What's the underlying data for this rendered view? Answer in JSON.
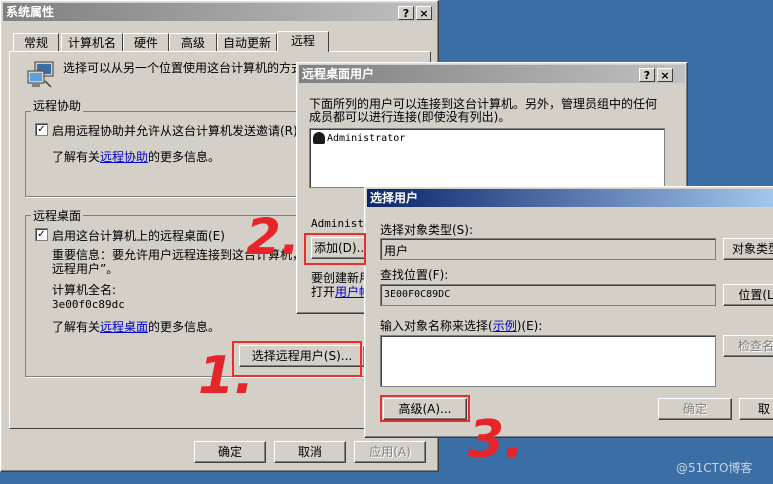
{
  "sysprops": {
    "title": "系统属性",
    "tabs": [
      "常规",
      "计算机名",
      "硬件",
      "高级",
      "自动更新",
      "远程"
    ],
    "intro": "选择可以从另一个位置使用这台计算机的方式",
    "assist": {
      "group_label": "远程协助",
      "check_label": "启用远程协助并允许从这台计算机发送邀请(R)",
      "learn_prefix": "了解有关",
      "learn_link": "远程协助",
      "learn_suffix": "的更多信息。"
    },
    "desktop": {
      "group_label": "远程桌面",
      "check_label": "启用这台计算机上的远程桌面(E)",
      "important1": "重要信息：要允许用户远程连接到这台计算机，",
      "important2": "远程用户”。",
      "fullname_label": "计算机全名:",
      "fullname": "3e00f0c89dc",
      "learn_prefix": "了解有关",
      "learn_link": "远程桌面",
      "learn_suffix": "的更多信息。",
      "select_users_btn": "选择远程用户(S)..."
    },
    "buttons": {
      "ok": "确定",
      "cancel": "取消",
      "apply": "应用(A)"
    }
  },
  "rdu": {
    "title": "远程桌面用户",
    "desc1": "下面所列的用户可以连接到这台计算机。另外，管理员组中的任何",
    "desc2": "成员都可以进行连接(即使没有列出)。",
    "users": [
      "Administrator"
    ],
    "status": "Administr",
    "add_btn": "添加(D)...",
    "create1": "要创建新用",
    "create2_prefix": "打开",
    "create2_link": "用户帐"
  },
  "sel": {
    "title": "选择用户",
    "objtype_label": "选择对象类型(S):",
    "objtype_value": "用户",
    "objtype_btn": "对象类型",
    "location_label": "查找位置(F):",
    "location_value": "3E00F0C89DC",
    "location_btn": "位置(L",
    "names_label_prefix": "输入对象名称来选择(",
    "names_label_link": "示例",
    "names_label_suffix": ")(E):",
    "check_btn": "检查名",
    "advanced_btn": "高级(A)...",
    "ok_btn": "确定",
    "cancel_btn": "取"
  },
  "annotations": [
    "1.",
    "2.",
    "3."
  ],
  "watermark": "@51CTO博客"
}
